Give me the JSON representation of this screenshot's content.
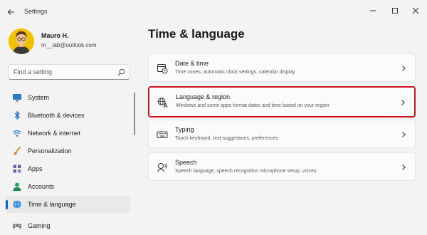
{
  "app": {
    "title": "Settings"
  },
  "user": {
    "name": "Mauro H.",
    "email": "m__lab@outlook.com"
  },
  "search": {
    "placeholder": "Find a setting"
  },
  "sidebar": {
    "items": [
      {
        "label": "System",
        "icon": "monitor-icon"
      },
      {
        "label": "Bluetooth & devices",
        "icon": "bluetooth-icon"
      },
      {
        "label": "Network & internet",
        "icon": "wifi-icon"
      },
      {
        "label": "Personalization",
        "icon": "brush-icon"
      },
      {
        "label": "Apps",
        "icon": "apps-icon"
      },
      {
        "label": "Accounts",
        "icon": "person-icon"
      },
      {
        "label": "Time & language",
        "icon": "globe-clock-icon",
        "active": true
      },
      {
        "label": "Gaming",
        "icon": "gamepad-icon"
      }
    ]
  },
  "main": {
    "title": "Time & language",
    "cards": [
      {
        "title": "Date & time",
        "description": "Time zones, automatic clock settings, calendar display",
        "icon": "clock-icon"
      },
      {
        "title": "Language & region",
        "description": "Windows and some apps format dates and time based on your region",
        "icon": "language-icon",
        "highlighted": true
      },
      {
        "title": "Typing",
        "description": "Touch keyboard, text suggestions, preferences",
        "icon": "keyboard-icon"
      },
      {
        "title": "Speech",
        "description": "Speech language, speech recognition microphone setup, voices",
        "icon": "microphone-icon"
      }
    ]
  },
  "colors": {
    "accent": "#0067c0",
    "highlight_border": "#d0101a",
    "background": "#f3f3f3",
    "card": "#fbfbfb"
  }
}
